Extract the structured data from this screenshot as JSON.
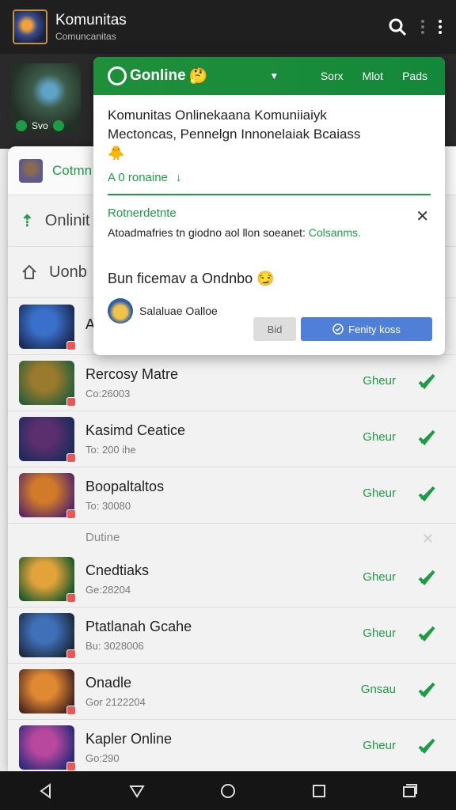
{
  "app": {
    "title": "Komunitas",
    "subtitle": "Comuncanitas"
  },
  "hero": {
    "badge": "Svo"
  },
  "sheet": {
    "row1_label": "Cotmn",
    "row2_label": "Onlinit",
    "row3_label": "Uonb"
  },
  "dialog": {
    "brand": "Gonline",
    "tabs": [
      "Sorx",
      "Mlot",
      "Pads"
    ],
    "text_line1": "Komunitas Onlinekaana Komuniiaiyk",
    "text_line2": "Mectoncas, Pennelgn Innonelaiak Bcaiass",
    "emoji_line": "🐥",
    "expand_label": "A 0 ronaine",
    "notice_title": "Rotnerdetnte",
    "notice_body": "Atoadmafries tn giodno aol llon soeanet:",
    "notice_link": "Colsanms.",
    "line2": "Bun ficemav a Ondnbo 😏",
    "user_name": "Salaluae Oalloe",
    "btn_secondary": "Bid",
    "btn_primary": "Fenity koss"
  },
  "list": {
    "items": [
      {
        "name": "A",
        "meta": "",
        "status": "",
        "colors": [
          "#3a70c9",
          "#1a2a55"
        ]
      },
      {
        "name": "Rercosy Matre",
        "meta": "Co:26003",
        "status": "Gheur",
        "colors": [
          "#9a7a2c",
          "#2b5f3b"
        ]
      },
      {
        "name": "Kasimd Ceatice",
        "meta": "To: 200 ihe",
        "status": "Gheur",
        "colors": [
          "#5b2f6d",
          "#1c2b5c"
        ]
      },
      {
        "name": "Boopaltaltos",
        "meta": "To: 30080",
        "status": "Gheur",
        "colors": [
          "#d07a2a",
          "#5a2a64"
        ]
      },
      {
        "name": "Cnedtiaks",
        "meta": "Ge:28204",
        "status": "Gheur",
        "colors": [
          "#e2a33a",
          "#1f5a2c"
        ]
      },
      {
        "name": "Ptatlanah Gcahe",
        "meta": "Bu: 3028006",
        "status": "Gheur",
        "colors": [
          "#3f70b8",
          "#1d2a3e"
        ]
      },
      {
        "name": "Onadle",
        "meta": "Gor 2122204",
        "status": "Gnsau",
        "colors": [
          "#e08832",
          "#4b2820"
        ]
      },
      {
        "name": "Kapler Online",
        "meta": "Go:290",
        "status": "Gheur",
        "colors": [
          "#b7489e",
          "#2c2a7a"
        ]
      }
    ],
    "separator": "Dutine"
  },
  "colors": {
    "accent": "#1e9b45",
    "primary_btn": "#4f7fd6"
  }
}
